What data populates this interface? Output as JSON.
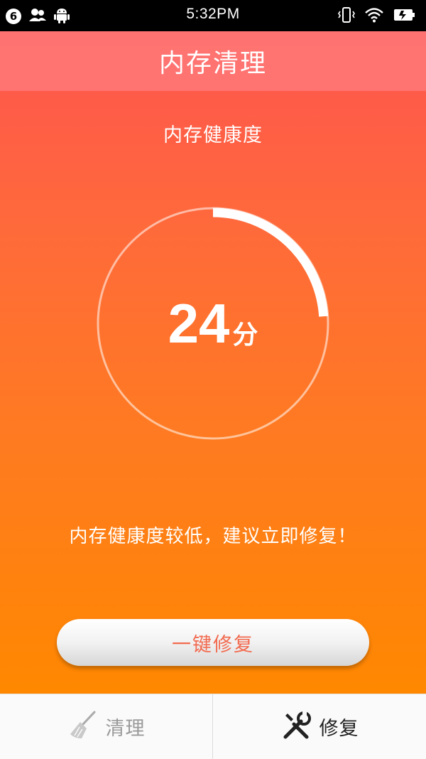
{
  "status_bar": {
    "notification_count": "6",
    "time": "5:32PM",
    "icons": [
      "notification-badge",
      "users-icon",
      "android-icon",
      "vibrate-icon",
      "wifi-icon",
      "battery-charging-icon"
    ]
  },
  "header": {
    "title": "内存清理"
  },
  "health": {
    "label": "内存健康度",
    "score": "24",
    "unit": "分",
    "progress_fraction": 0.24
  },
  "advice": "内存健康度较低，建议立即修复！",
  "action_button": {
    "label": "一键修复",
    "color": "#f26a4f"
  },
  "tabs": [
    {
      "label": "清理",
      "icon": "broom-icon",
      "active": false
    },
    {
      "label": "修复",
      "icon": "wrench-screwdriver-icon",
      "active": true
    }
  ],
  "colors": {
    "gradient_top": "#ff5450",
    "gradient_bottom": "#ff8800",
    "title_bar": "#ff7878"
  }
}
